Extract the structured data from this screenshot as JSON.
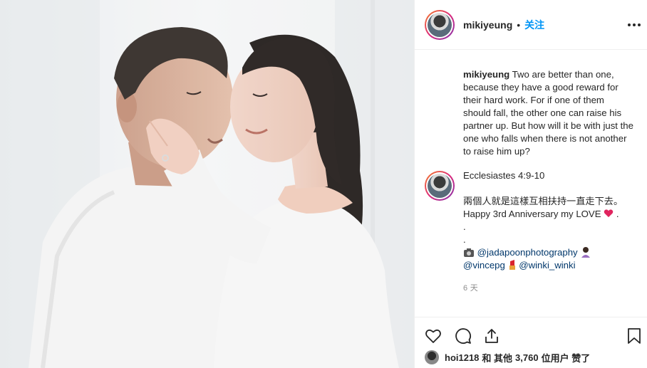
{
  "post": {
    "username": "mikiyeung",
    "separator": "•",
    "follow_label": "关注",
    "caption": "Two are better than one, because they have a good reward for their hard work. For if one of them should fall, the other one can raise his partner up. But how will it be with just the one who falls when there is not another to raise him up?",
    "comment": {
      "verse": "Ecclesiastes 4:9-10",
      "chinese": "兩個人就是這樣互相扶持一直走下去。",
      "anniversary": "Happy 3rd Anniversary my LOVE",
      "anniversary_suffix": " .",
      "dot1": ".",
      "dot2": ".",
      "tag1": "@jadapoonphotography",
      "tag2": "@vincepg",
      "tag3": "@winki_winki"
    },
    "time": "6 天"
  },
  "likes": {
    "user": "hoi1218",
    "conj": "和 其他",
    "count": "3,760",
    "suffix": "位用户 赞了"
  },
  "icons": {
    "more": "more-horizontal-icon",
    "like": "heart-icon",
    "comment": "comment-icon",
    "share": "share-icon",
    "save": "bookmark-icon"
  },
  "colors": {
    "follow": "#0095f6",
    "tag": "#00376b",
    "heart_emoji": "#e0245e"
  }
}
